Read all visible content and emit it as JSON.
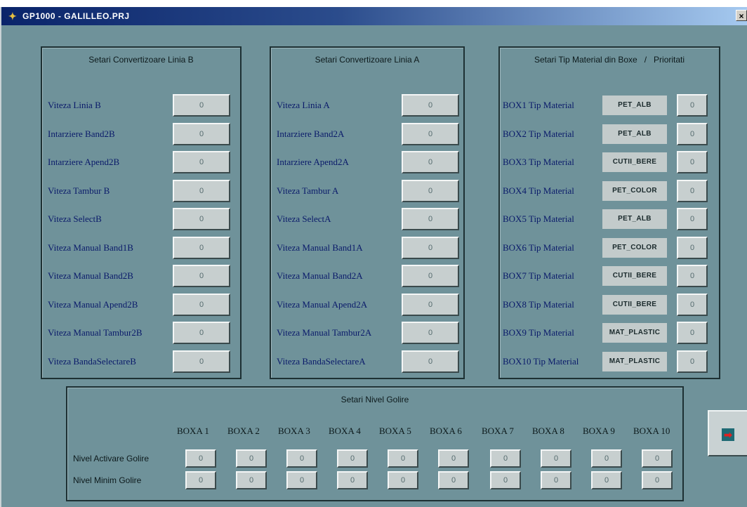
{
  "window": {
    "title": "GP1000 - GALILLEO.PRJ",
    "close": "×"
  },
  "panel_b": {
    "title": "Setari Convertizoare Linia B",
    "rows": [
      {
        "label": "Viteza Linia B",
        "value": "0"
      },
      {
        "label": "Intarziere Band2B",
        "value": "0"
      },
      {
        "label": "Intarziere Apend2B",
        "value": "0"
      },
      {
        "label": "Viteza Tambur B",
        "value": "0"
      },
      {
        "label": "Viteza SelectB",
        "value": "0"
      },
      {
        "label": "Viteza Manual Band1B",
        "value": "0"
      },
      {
        "label": "Viteza Manual Band2B",
        "value": "0"
      },
      {
        "label": "Viteza Manual Apend2B",
        "value": "0"
      },
      {
        "label": "Viteza Manual Tambur2B",
        "value": "0"
      },
      {
        "label": "Viteza BandaSelectareB",
        "value": "0"
      }
    ]
  },
  "panel_a": {
    "title": "Setari Convertizoare Linia A",
    "rows": [
      {
        "label": "Viteza Linia A",
        "value": "0"
      },
      {
        "label": "Intarziere Band2A",
        "value": "0"
      },
      {
        "label": "Intarziere Apend2A",
        "value": "0"
      },
      {
        "label": "Viteza Tambur A",
        "value": "0"
      },
      {
        "label": "Viteza SelectA",
        "value": "0"
      },
      {
        "label": "Viteza Manual Band1A",
        "value": "0"
      },
      {
        "label": "Viteza Manual Band2A",
        "value": "0"
      },
      {
        "label": "Viteza Manual Apend2A",
        "value": "0"
      },
      {
        "label": "Viteza Manual Tambur2A",
        "value": "0"
      },
      {
        "label": "Viteza BandaSelectareA",
        "value": "0"
      }
    ]
  },
  "panel_boxes": {
    "title": "Setari Tip Material din Boxe   /   Prioritati",
    "rows": [
      {
        "label": "BOX1 Tip Material",
        "material": "PET_ALB",
        "priority": "0"
      },
      {
        "label": "BOX2 Tip Material",
        "material": "PET_ALB",
        "priority": "0"
      },
      {
        "label": "BOX3 Tip Material",
        "material": "CUTII_BERE",
        "priority": "0"
      },
      {
        "label": "BOX4 Tip Material",
        "material": "PET_COLOR",
        "priority": "0"
      },
      {
        "label": "BOX5 Tip Material",
        "material": "PET_ALB",
        "priority": "0"
      },
      {
        "label": "BOX6 Tip Material",
        "material": "PET_COLOR",
        "priority": "0"
      },
      {
        "label": "BOX7 Tip Material",
        "material": "CUTII_BERE",
        "priority": "0"
      },
      {
        "label": "BOX8 Tip Material",
        "material": "CUTII_BERE",
        "priority": "0"
      },
      {
        "label": "BOX9 Tip Material",
        "material": "MAT_PLASTIC",
        "priority": "0"
      },
      {
        "label": "BOX10 Tip Material",
        "material": "MAT_PLASTIC",
        "priority": "0"
      }
    ]
  },
  "panel_golire": {
    "title": "Setari Nivel Golire",
    "columns": [
      "BOXA 1",
      "BOXA 2",
      "BOXA 3",
      "BOXA 4",
      "BOXA 5",
      "BOXA 6",
      "BOXA 7",
      "BOXA 8",
      "BOXA 9",
      "BOXA 10"
    ],
    "row_activare": {
      "label": "Nivel Activare Golire",
      "values": [
        "0",
        "0",
        "0",
        "0",
        "0",
        "0",
        "0",
        "0",
        "0",
        "0"
      ]
    },
    "row_minim": {
      "label": "Nivel Minim Golire",
      "values": [
        "0",
        "0",
        "0",
        "0",
        "0",
        "0",
        "0",
        "0",
        "0",
        "0"
      ]
    }
  },
  "nav": {
    "next_icon": "arrow-right-icon",
    "glyph": "➡"
  },
  "colors": {
    "background": "#6f929a",
    "label_text": "#0a1a6a",
    "field": "#c7cfcf",
    "title_bar": "#0a246a"
  }
}
